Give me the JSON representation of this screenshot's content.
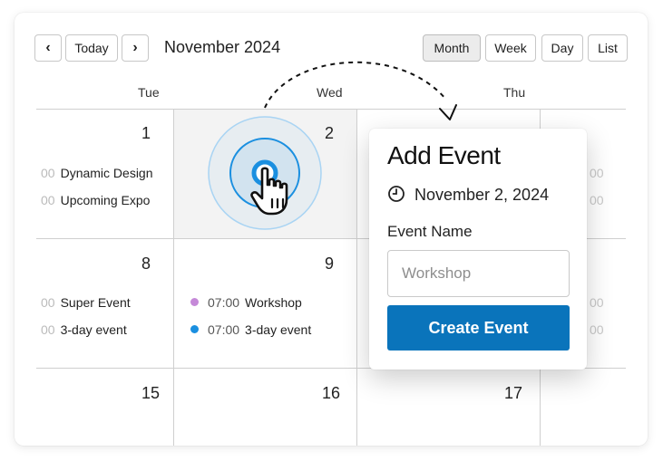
{
  "toolbar": {
    "prev": "‹",
    "today": "Today",
    "next": "›",
    "title": "November 2024",
    "views": [
      "Month",
      "Week",
      "Day",
      "List"
    ],
    "active_view": "Month"
  },
  "weekdays": [
    "Tue",
    "Wed",
    "Thu"
  ],
  "weeks": [
    {
      "days": [
        "1",
        "2",
        ""
      ]
    },
    {
      "days": [
        "8",
        "9",
        ""
      ]
    },
    {
      "days": [
        "15",
        "16",
        "17"
      ]
    }
  ],
  "events": {
    "d1": [
      {
        "time": "00",
        "name": "Dynamic Design"
      },
      {
        "time": "00",
        "name": "Upcoming Expo"
      }
    ],
    "d8": [
      {
        "time": "00",
        "name": "Super Event"
      },
      {
        "time": "00",
        "name": "3-day event"
      }
    ],
    "d9": [
      {
        "time": "07:00",
        "name": "Workshop",
        "color": "#c589d8"
      },
      {
        "time": "07:00",
        "name": "3-day event",
        "color": "#1a8fe0"
      }
    ],
    "right_faded": [
      "00",
      "00",
      "00",
      "00"
    ]
  },
  "popup": {
    "title": "Add Event",
    "date": "November 2, 2024",
    "field_label": "Event Name",
    "placeholder": "Workshop",
    "submit": "Create Event"
  },
  "colors": {
    "primary": "#0a74bb",
    "ripple": "#1a8fe0"
  },
  "icons": [
    "chevron-left-icon",
    "chevron-right-icon",
    "clock-icon",
    "hand-pointer-icon"
  ]
}
